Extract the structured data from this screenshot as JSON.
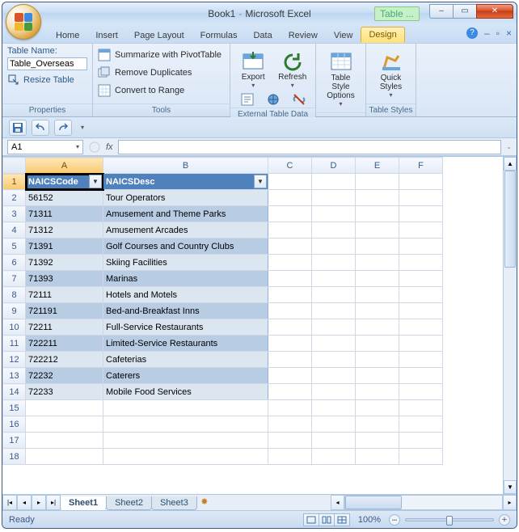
{
  "title": {
    "doc": "Book1",
    "app": "Microsoft Excel",
    "context_tab_group": "Table ..."
  },
  "window_controls": {
    "min": "–",
    "max": "▭",
    "close": "✕"
  },
  "ribbon_tabs": [
    "Home",
    "Insert",
    "Page Layout",
    "Formulas",
    "Data",
    "Review",
    "View",
    "Design"
  ],
  "active_ribbon_tab": "Design",
  "ribbon": {
    "properties": {
      "label": "Properties",
      "table_name_label": "Table Name:",
      "table_name_value": "Table_Overseas",
      "resize_label": "Resize Table"
    },
    "tools": {
      "label": "Tools",
      "pivot": "Summarize with PivotTable",
      "dedupe": "Remove Duplicates",
      "range": "Convert to Range"
    },
    "ext": {
      "label": "External Table Data",
      "export": "Export",
      "refresh": "Refresh"
    },
    "tso": {
      "label": "",
      "btn": "Table Style Options"
    },
    "ts": {
      "label": "Table Styles",
      "btn": "Quick Styles"
    }
  },
  "namebox": "A1",
  "fx_label": "fx",
  "columns": [
    "A",
    "B",
    "C",
    "D",
    "E",
    "F"
  ],
  "row_numbers": [
    1,
    2,
    3,
    4,
    5,
    6,
    7,
    8,
    9,
    10,
    11,
    12,
    13,
    14,
    15,
    16,
    17,
    18
  ],
  "table": {
    "headers": [
      "NAICSCode",
      "NAICSDesc"
    ],
    "rows": [
      [
        "56152",
        "Tour Operators"
      ],
      [
        "71311",
        "Amusement and Theme Parks"
      ],
      [
        "71312",
        "Amusement Arcades"
      ],
      [
        "71391",
        "Golf Courses and Country Clubs"
      ],
      [
        "71392",
        "Skiing Facilities"
      ],
      [
        "71393",
        "Marinas"
      ],
      [
        "72111",
        "Hotels and Motels"
      ],
      [
        "721191",
        "Bed-and-Breakfast Inns"
      ],
      [
        "72211",
        "Full-Service Restaurants"
      ],
      [
        "722211",
        "Limited-Service Restaurants"
      ],
      [
        "722212",
        "Cafeterias"
      ],
      [
        "72232",
        "Caterers"
      ],
      [
        "72233",
        "Mobile Food Services"
      ]
    ]
  },
  "chart_data": {
    "type": "table",
    "columns": [
      "NAICSCode",
      "NAICSDesc"
    ],
    "rows": [
      [
        "56152",
        "Tour Operators"
      ],
      [
        "71311",
        "Amusement and Theme Parks"
      ],
      [
        "71312",
        "Amusement Arcades"
      ],
      [
        "71391",
        "Golf Courses and Country Clubs"
      ],
      [
        "71392",
        "Skiing Facilities"
      ],
      [
        "71393",
        "Marinas"
      ],
      [
        "72111",
        "Hotels and Motels"
      ],
      [
        "721191",
        "Bed-and-Breakfast Inns"
      ],
      [
        "72211",
        "Full-Service Restaurants"
      ],
      [
        "722211",
        "Limited-Service Restaurants"
      ],
      [
        "722212",
        "Cafeterias"
      ],
      [
        "72232",
        "Caterers"
      ],
      [
        "72233",
        "Mobile Food Services"
      ]
    ]
  },
  "sheet_tabs": [
    "Sheet1",
    "Sheet2",
    "Sheet3"
  ],
  "active_sheet_tab": "Sheet1",
  "status": {
    "ready": "Ready",
    "zoom": "100%"
  }
}
